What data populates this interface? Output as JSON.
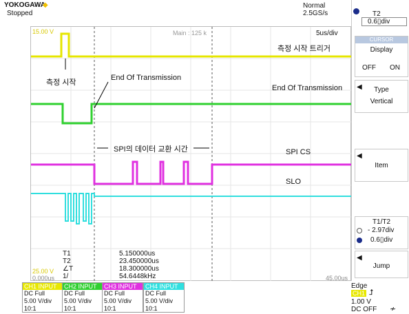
{
  "header": {
    "brand": "YOKOGAWA",
    "brand_mark": "◆",
    "run_state": "Stopped",
    "mode": "Normal",
    "sample_rate": "2.5GS/s"
  },
  "plot": {
    "top_left_voltage": "15.00 V",
    "main_info": "Main : 125 k",
    "time_div": "5us/div",
    "bottom_left_voltage": "25.00 V",
    "bottom_left_time": "0.000us",
    "bottom_right_time": "45.00us",
    "labels": {
      "trigger": "측정 시작 트리거",
      "start": "측정 시작",
      "eot_left": "End Of Transmission",
      "eot_right": "End Of Transmission",
      "spi_exchange": "SPI의 데이터 교환 시간",
      "spi_cs": "SPI CS",
      "slo": "SLO"
    },
    "measurements": [
      {
        "name": "T1",
        "value": "5.150000us"
      },
      {
        "name": "T2",
        "value": "23.450000us"
      },
      {
        "name": "∠T",
        "value": "18.300000us"
      },
      {
        "name": "1/∠T",
        "value": "54.6448kHz"
      }
    ]
  },
  "sidebar": {
    "t2_title": "T2",
    "t2_value": "0.6▯div",
    "cursor_label": "CURSOR",
    "display_title": "Display",
    "display_off": "OFF",
    "display_on": "ON",
    "type_title": "Type",
    "type_value": "Vertical",
    "item_label": "Item",
    "t1t2_title": "T1/T2",
    "t1_value": "- 2.97div",
    "t2b_value": "0.6▯div",
    "jump_label": "Jump"
  },
  "footer": {
    "channels": [
      {
        "head": "CH1 INPUT",
        "coupling": "DC Full",
        "scale": "5.00 V/div",
        "probe": "10:1",
        "color": "#e8e800"
      },
      {
        "head": "CH2 INPUT",
        "coupling": "DC Full",
        "scale": "5.00 V/div",
        "probe": "10:1",
        "color": "#30d030"
      },
      {
        "head": "CH3 INPUT",
        "coupling": "DC Full",
        "scale": "5.00 V/div",
        "probe": "10:1",
        "color": "#e030e0"
      },
      {
        "head": "CH4 INPUT",
        "coupling": "DC Full",
        "scale": "5.00 V/div",
        "probe": "10:1",
        "color": "#30e0e0"
      }
    ],
    "trigger_mode": "Edge",
    "trigger_source": "CH1",
    "trigger_level": "1.00 V",
    "trigger_coupling": "DC OFF"
  }
}
